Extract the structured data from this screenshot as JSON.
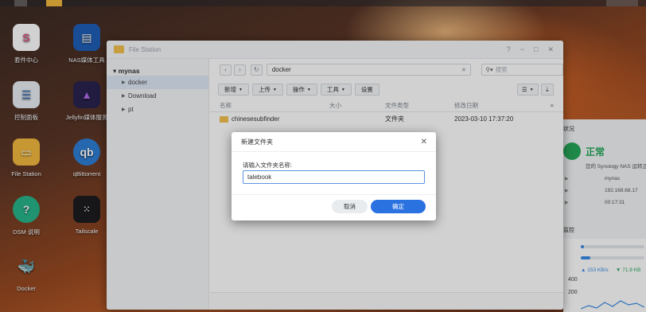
{
  "desktop_icons": [
    {
      "label": "套件中心",
      "icon": "package-center-icon",
      "color": "#ffffff"
    },
    {
      "label": "NAS媒体工具",
      "icon": "nas-media-tool-icon",
      "color": "#1f5fb8"
    },
    {
      "label": "控制面板",
      "icon": "control-panel-icon",
      "color": "#e9eef5"
    },
    {
      "label": "Jellyfin媒体服务",
      "icon": "jellyfin-icon",
      "color": "#2a2350"
    },
    {
      "label": "File Station",
      "icon": "file-station-icon",
      "color": "#f2b93d"
    },
    {
      "label": "qBittorrent",
      "icon": "qbittorrent-icon",
      "color": "#2e7fd6"
    },
    {
      "label": "DSM 说明",
      "icon": "dsm-help-icon",
      "color": "#28b48a"
    },
    {
      "label": "Tailscale",
      "icon": "tailscale-icon",
      "color": "#1d1d1f"
    },
    {
      "label": "Docker",
      "icon": "docker-icon",
      "color": "#2496ed"
    }
  ],
  "window": {
    "title": "File Station",
    "controls": [
      "?",
      "−",
      "□",
      "✕"
    ]
  },
  "sidebar": {
    "root": "mynas",
    "items": [
      {
        "label": "docker",
        "selected": true
      },
      {
        "label": "Download",
        "selected": false
      },
      {
        "label": "pt",
        "selected": false
      }
    ]
  },
  "address": {
    "path": "docker",
    "search_placeholder": "搜索"
  },
  "toolbar": {
    "new_label": "新增",
    "upload_label": "上传",
    "action_label": "操作",
    "tools_label": "工具",
    "settings_label": "设置"
  },
  "table": {
    "headers": [
      "名称",
      "大小",
      "文件类型",
      "修改日期"
    ],
    "rows": [
      {
        "name": "chinesesubfinder",
        "size": "",
        "type": "文件夹",
        "modified": "2023-03-10 17:37:20"
      }
    ]
  },
  "dialog": {
    "title": "新建文件夹",
    "label": "请输入文件夹名称:",
    "value": "talebook",
    "cancel_label": "取消",
    "ok_label": "确定"
  },
  "widget": {
    "header": "状况",
    "status": "正常",
    "status_sub": "您的 Synology NAS 运转正",
    "hostname": "mynas",
    "ip": "192.168.68.17",
    "uptime": "00:17:31",
    "monitor_header": "监控",
    "upload_speed": "153 KB/s",
    "download_speed": "71.9 KB",
    "axis_400": "400",
    "axis_200": "200",
    "cpu_fraction": 0.05,
    "ram_fraction": 0.15
  },
  "colors": {
    "accent": "#2a72e0",
    "status_ok": "#27a85a"
  }
}
